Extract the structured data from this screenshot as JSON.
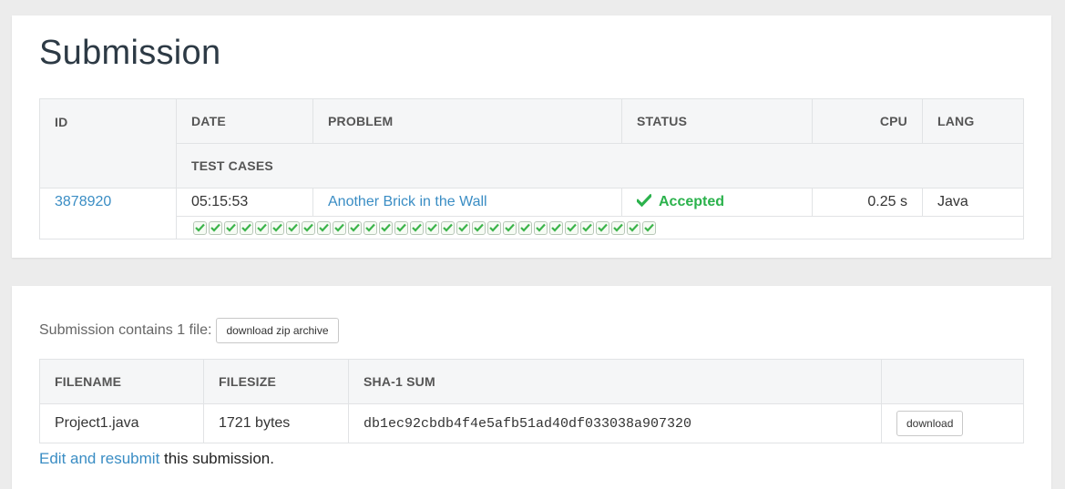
{
  "page": {
    "title": "Submission"
  },
  "submission_table": {
    "headers": {
      "id": "ID",
      "date": "DATE",
      "problem": "PROBLEM",
      "status": "STATUS",
      "cpu": "CPU",
      "lang": "LANG",
      "test_cases": "TEST CASES"
    },
    "row": {
      "id": "3878920",
      "date": "05:15:53",
      "problem": "Another Brick in the Wall",
      "status": "Accepted",
      "status_icon": "checkmark-icon",
      "status_color": "#2bb24c",
      "cpu": "0.25 s",
      "lang": "Java"
    },
    "test_cases": {
      "total": 30,
      "passed": 30,
      "icon": "checkmark-icon"
    }
  },
  "files_section": {
    "intro": "Submission contains 1 file:",
    "zip_button": "download zip archive",
    "headers": {
      "filename": "FILENAME",
      "filesize": "FILESIZE",
      "sha1": "SHA-1 SUM",
      "action": ""
    },
    "files": [
      {
        "filename": "Project1.java",
        "filesize": "1721 bytes",
        "sha1": "db1ec92cbdb4f4e5afb51ad40df033038a907320",
        "download_label": "download"
      }
    ]
  },
  "resubmit": {
    "link": "Edit and resubmit",
    "text": " this submission."
  },
  "colors": {
    "link": "#3a8dc4",
    "accepted": "#2bb24c",
    "background": "#ececec"
  }
}
